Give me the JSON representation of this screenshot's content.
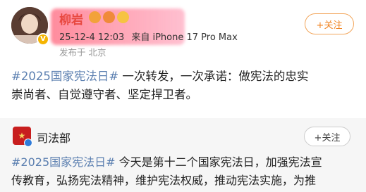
{
  "user": {
    "name": "柳岩",
    "timestamp": "25-12-4 12:03",
    "device": "来自 iPhone 17 Pro Max",
    "location": "发布于 北京"
  },
  "follow_button": {
    "label": "+关注"
  },
  "post": {
    "topic": "#2025国家宪法日#",
    "text_line1": " 一次转发，一次承诺：做宪法的忠实",
    "text_line2": "崇尚者、自觉遵守者、坚定捍卫者。"
  },
  "repost": {
    "account": "司法部",
    "follow_label": "+关注",
    "topic": "#2025国家宪法日#",
    "text_line1": " 今天是第十二个国家宪法日，加强宪法宣",
    "text_line2": "传教育，弘扬宪法精神，维护宪法权威，推动宪法实施，为推"
  },
  "colors": {
    "username": "#e8483f",
    "topic_link": "#5b7fb0",
    "follow_orange": "#f08320",
    "card_background": "#f6f6f6"
  },
  "icons": [
    "avatar",
    "verified-badge-icon",
    "emoji-badge-icons",
    "ministry-logo-icon",
    "blue-verified-icon"
  ]
}
